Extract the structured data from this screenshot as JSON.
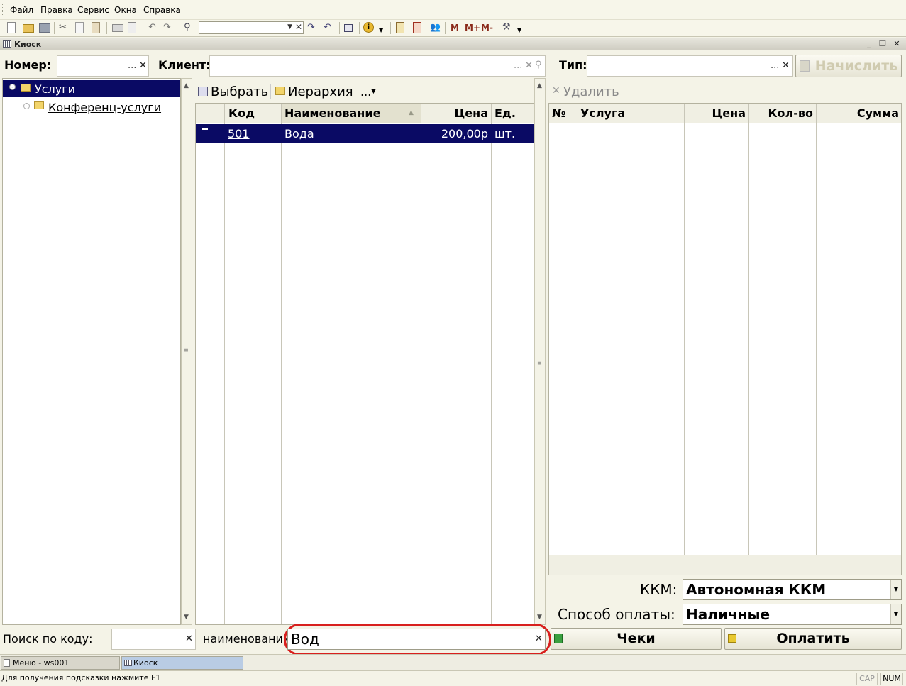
{
  "menu": [
    "Файл",
    "Правка",
    "Сервис",
    "Окна",
    "Справка"
  ],
  "toolbar": {
    "m": "M",
    "mplus": "M+",
    "mminus": "M-"
  },
  "window": {
    "title": "Киоск"
  },
  "header": {
    "number_label": "Номер:",
    "client_label": "Клиент:",
    "type_label": "Тип:",
    "charge_button": "Начислить"
  },
  "tree": {
    "items": [
      {
        "label": "Услуги"
      },
      {
        "label": "Конференц-услуги"
      }
    ]
  },
  "services": {
    "select_label": "Выбрать",
    "hierarchy_label": "Иерархия",
    "more_label": "...",
    "columns": {
      "code": "Код",
      "name": "Наименование",
      "price": "Цена",
      "unit": "Ед. ..."
    },
    "rows": [
      {
        "code": "501",
        "name": "Вода",
        "price": "200,00р",
        "unit": "шт."
      }
    ]
  },
  "check": {
    "delete_label": "Удалить",
    "columns": {
      "num": "№",
      "service": "Услуга",
      "price": "Цена",
      "qty": "Кол-во",
      "sum": "Сумма"
    }
  },
  "kkm": {
    "label": "ККМ:",
    "value": "Автономная ККМ"
  },
  "payment": {
    "label": "Способ оплаты:",
    "value": "Наличные"
  },
  "search": {
    "code_label": "Поиск по коду:",
    "name_label": "наименованию",
    "name_value": "Вод"
  },
  "buttons": {
    "checks": "Чеки",
    "pay": "Оплатить"
  },
  "taskbar": [
    "Меню - ws001",
    "Киоск"
  ],
  "status": {
    "hint": "Для получения подсказки нажмите F1",
    "cap": "CAP",
    "num": "NUM"
  },
  "colors": {
    "selection": "#0a0a64",
    "highlight": "#d8201e"
  }
}
